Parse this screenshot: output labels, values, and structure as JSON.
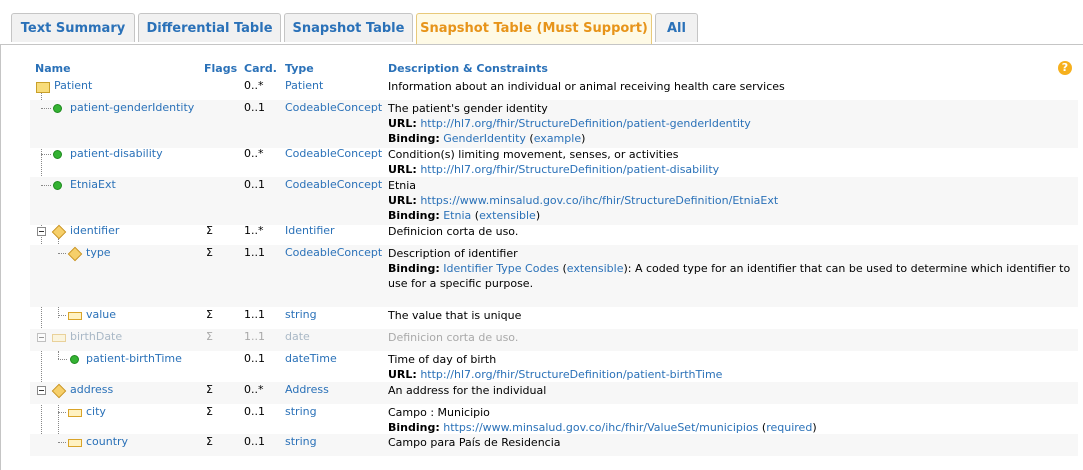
{
  "tabs": [
    "Text Summary",
    "Differential Table",
    "Snapshot Table",
    "Snapshot Table (Must Support)",
    "All"
  ],
  "headers": {
    "name": "Name",
    "flags": "Flags",
    "card": "Card.",
    "type": "Type",
    "desc": "Description & Constraints"
  },
  "help_icon": "?",
  "rows": [
    {
      "name": "Patient",
      "flags": "",
      "card": "0..*",
      "type": "Patient",
      "desc": "Information about an individual or animal receiving health care services"
    },
    {
      "name": "patient-genderIdentity",
      "flags": "",
      "card": "0..1",
      "type": "CodeableConcept",
      "desc": "The patient's gender identity",
      "url_label": "URL:",
      "url": "http://hl7.org/fhir/StructureDefinition/patient-genderIdentity",
      "binding_label": "Binding:",
      "binding": "GenderIdentity",
      "strength": "example"
    },
    {
      "name": "patient-disability",
      "flags": "",
      "card": "0..*",
      "type": "CodeableConcept",
      "desc": "Condition(s) limiting movement, senses, or activities",
      "url_label": "URL:",
      "url": "http://hl7.org/fhir/StructureDefinition/patient-disability"
    },
    {
      "name": "EtniaExt",
      "flags": "",
      "card": "0..1",
      "type": "CodeableConcept",
      "desc": "Etnia",
      "url_label": "URL:",
      "url": "https://www.minsalud.gov.co/ihc/fhir/StructureDefinition/EtniaExt",
      "binding_label": "Binding:",
      "binding": "Etnia",
      "strength": "extensible"
    },
    {
      "name": "identifier",
      "flags": "Σ",
      "card": "1..*",
      "type": "Identifier",
      "desc": "Definicion corta de uso."
    },
    {
      "name": "type",
      "flags": "Σ",
      "card": "1..1",
      "type": "CodeableConcept",
      "desc": "Description of identifier",
      "binding_label": "Binding:",
      "binding": "Identifier Type Codes",
      "strength": "extensible",
      "binding_tail": ": A coded type for an identifier that can be used to determine which identifier to use for a specific purpose."
    },
    {
      "name": "value",
      "flags": "Σ",
      "card": "1..1",
      "type": "string",
      "desc": "The value that is unique"
    },
    {
      "name": "birthDate",
      "flags": "Σ",
      "card": "1..1",
      "type": "date",
      "desc": "Definicion corta de uso."
    },
    {
      "name": "patient-birthTime",
      "flags": "",
      "card": "0..1",
      "type": "dateTime",
      "desc": "Time of day of birth",
      "url_label": "URL:",
      "url": "http://hl7.org/fhir/StructureDefinition/patient-birthTime"
    },
    {
      "name": "address",
      "flags": "Σ",
      "card": "0..*",
      "type": "Address",
      "desc": "An address for the individual"
    },
    {
      "name": "city",
      "flags": "Σ",
      "card": "0..1",
      "type": "string",
      "desc": "Campo : Municipio",
      "binding_label": "Binding:",
      "binding": "https://www.minsalud.gov.co/ihc/fhir/ValueSet/municipios",
      "strength": "required"
    },
    {
      "name": "country",
      "flags": "Σ",
      "card": "0..1",
      "type": "string",
      "desc": "Campo para País de Residencia"
    }
  ],
  "icons": {
    "resource": "folder-icon",
    "extension": "extension-dot-icon",
    "complex": "datatype-cube-icon",
    "primitive": "primitive-icon",
    "toggle": "collapse-toggle-icon"
  }
}
